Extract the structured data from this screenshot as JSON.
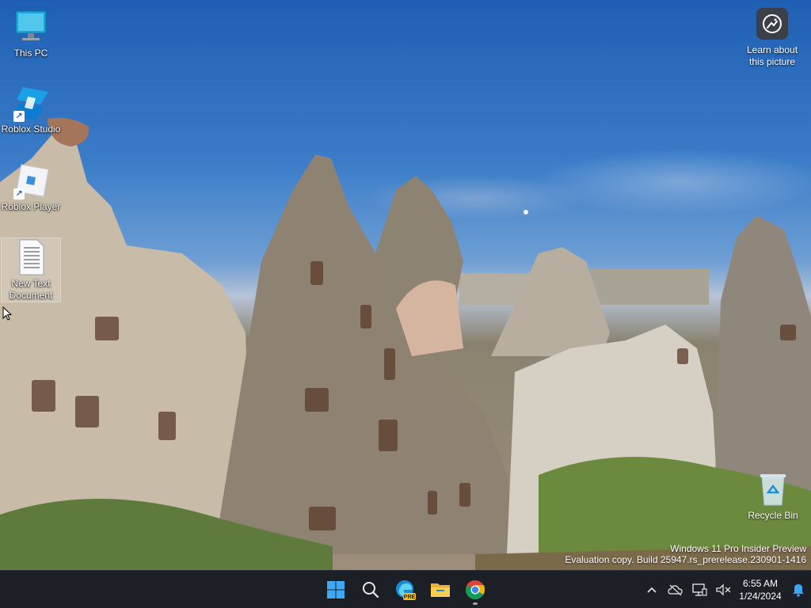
{
  "desktop": {
    "icons": [
      {
        "label": "This PC"
      },
      {
        "label": "Roblox Studio"
      },
      {
        "label": "Roblox Player"
      },
      {
        "label": "New Text Document"
      },
      {
        "label": "Recycle Bin"
      }
    ],
    "learn": {
      "label": "Learn about this picture"
    }
  },
  "watermark": {
    "line1": "Windows 11 Pro Insider Preview",
    "line2": "Evaluation copy. Build 25947.rs_prerelease.230901-1416"
  },
  "taskbar": {
    "apps": [
      {
        "name": "start-button",
        "icon": "windows-logo"
      },
      {
        "name": "search-button",
        "icon": "search-icon"
      },
      {
        "name": "edge-pre-button",
        "icon": "edge-icon",
        "badge": "PRE"
      },
      {
        "name": "file-explorer-button",
        "icon": "folder-icon"
      },
      {
        "name": "chrome-button",
        "icon": "chrome-icon"
      }
    ],
    "clock": {
      "time": "6:55 AM",
      "date": "1/24/2024"
    }
  },
  "colors": {
    "taskbar_bg": "#1c1f26",
    "accent": "#0078d4"
  }
}
